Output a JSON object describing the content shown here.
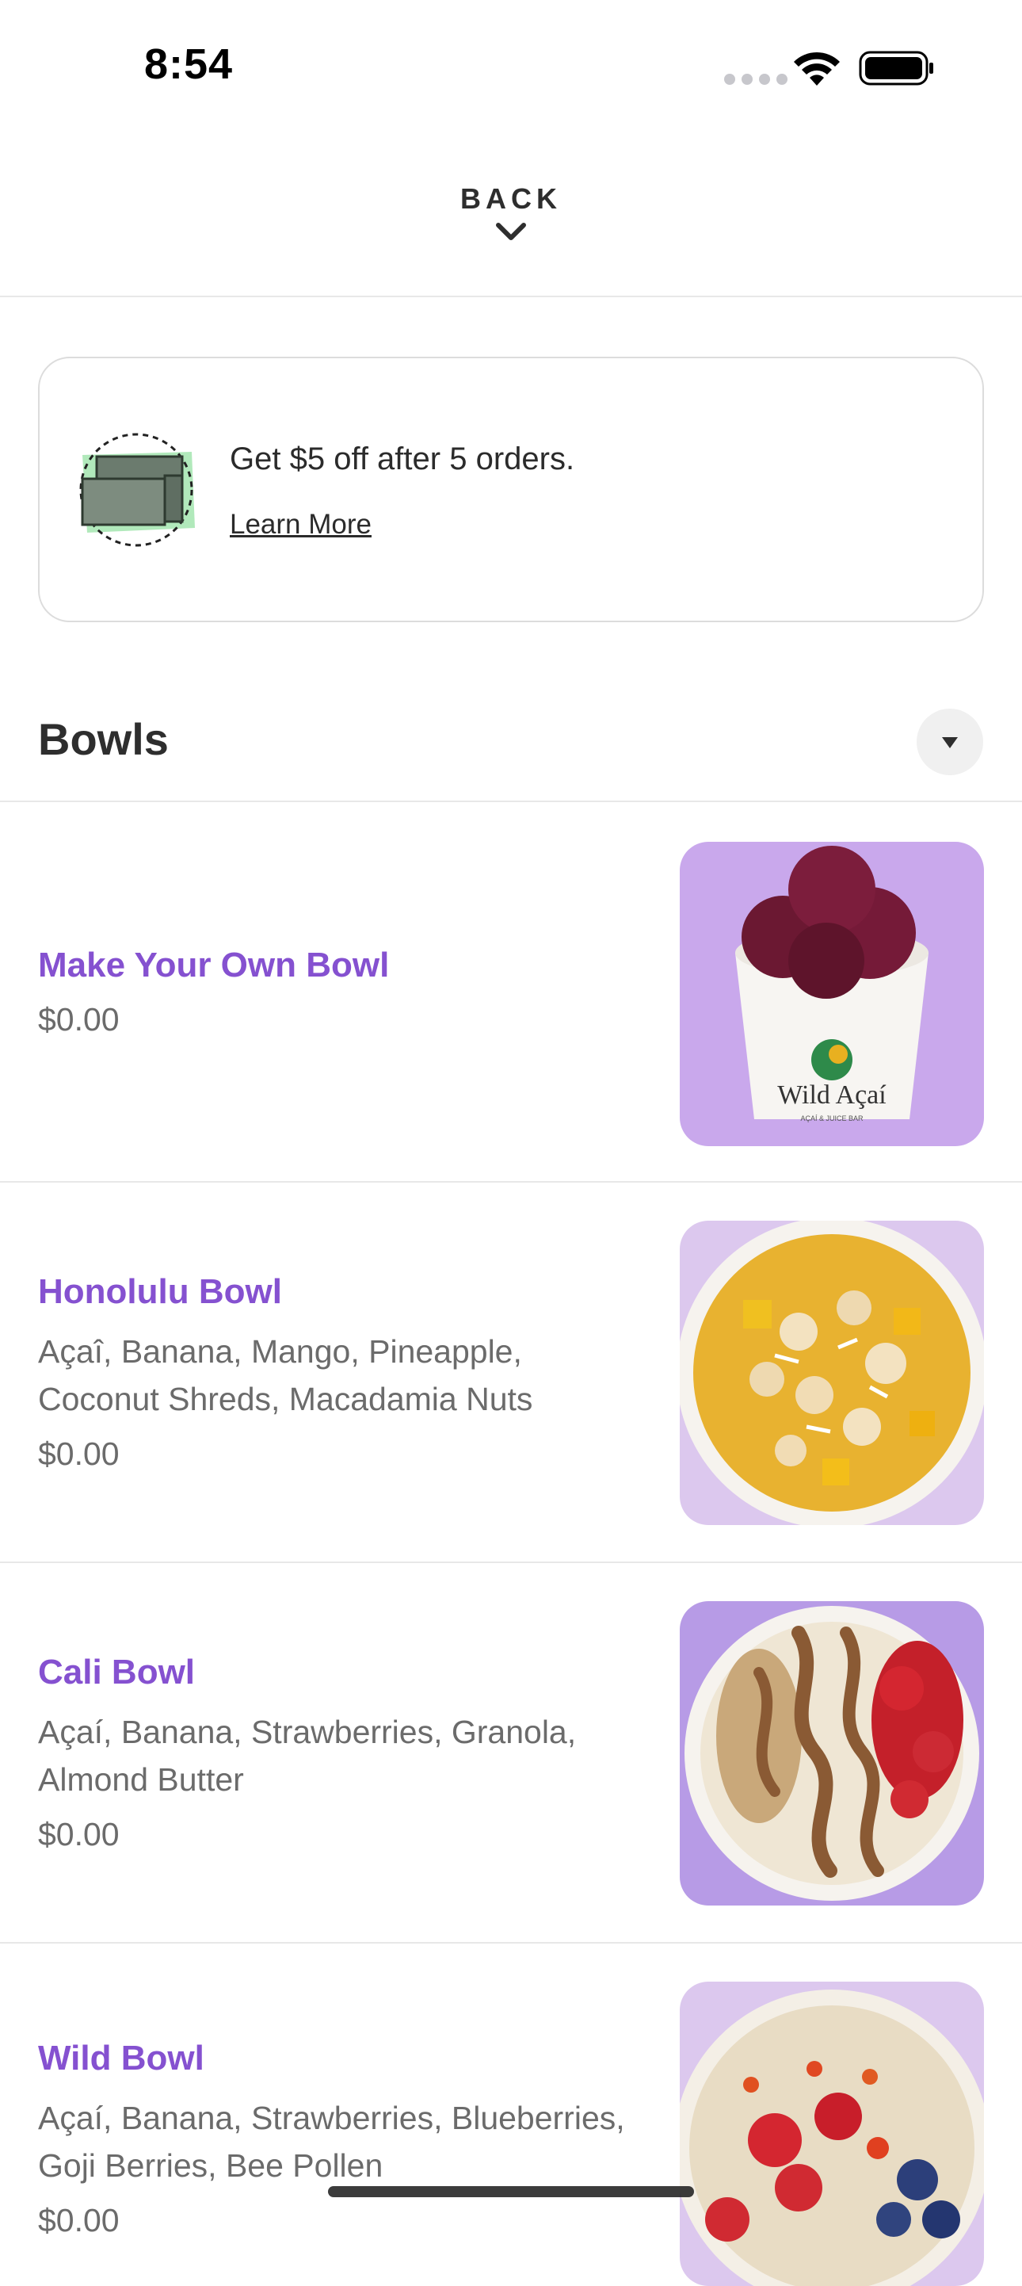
{
  "status_bar": {
    "time": "8:54"
  },
  "header": {
    "back_label": "BACK"
  },
  "rewards": {
    "text": "Get $5 off after 5 orders.",
    "link_label": "Learn More"
  },
  "section": {
    "title": "Bowls"
  },
  "items": [
    {
      "name": "Make Your Own Bowl",
      "description": "",
      "price": "$0.00",
      "image_brand": "Wild Açaí",
      "image_sub": "AÇAÍ & JUICE BAR"
    },
    {
      "name": "Honolulu Bowl",
      "description": "Açaî, Banana, Mango, Pineapple, Coconut Shreds, Macadamia Nuts",
      "price": "$0.00"
    },
    {
      "name": "Cali Bowl",
      "description": "Açaí, Banana, Strawberries, Granola, Almond Butter",
      "price": "$0.00"
    },
    {
      "name": "Wild Bowl",
      "description": "Açaí, Banana, Strawberries, Blueberries, Goji Berries, Bee Pollen",
      "price": "$0.00"
    }
  ],
  "colors": {
    "item_name": "#8551d0",
    "muted_text": "#6b6b6b",
    "border": "#e8e8e8",
    "image_bg": "#c9a8ec"
  }
}
